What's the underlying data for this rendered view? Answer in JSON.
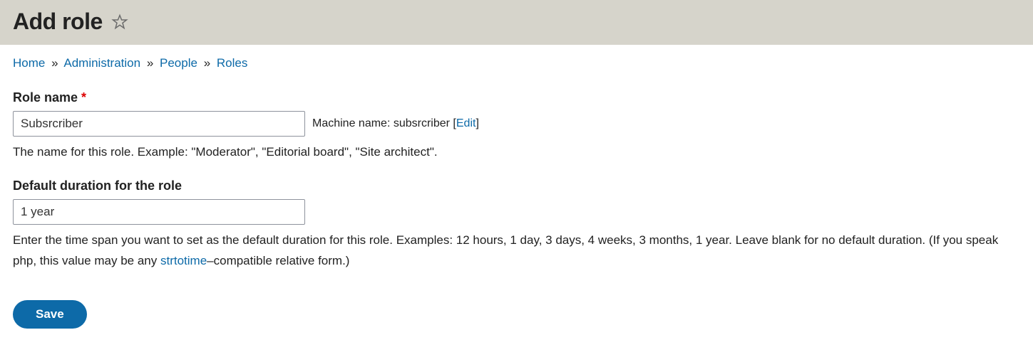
{
  "header": {
    "title": "Add role"
  },
  "breadcrumb": {
    "items": [
      {
        "label": "Home"
      },
      {
        "label": "Administration"
      },
      {
        "label": "People"
      },
      {
        "label": "Roles"
      }
    ]
  },
  "form": {
    "role_name": {
      "label": "Role name",
      "value": "Subsrcriber",
      "machine_label": "Machine name:",
      "machine_value": "subsrcriber",
      "edit_label": "Edit",
      "description": "The name for this role. Example: \"Moderator\", \"Editorial board\", \"Site architect\"."
    },
    "duration": {
      "label": "Default duration for the role",
      "value": "1 year",
      "description_before": "Enter the time span you want to set as the default duration for this role. Examples: 12 hours, 1 day, 3 days, 4 weeks, 3 months, 1 year. Leave blank for no default duration. (If you speak php, this value may be any ",
      "link_text": "strtotime",
      "description_after": "–compatible relative form.)"
    },
    "save_label": "Save"
  }
}
